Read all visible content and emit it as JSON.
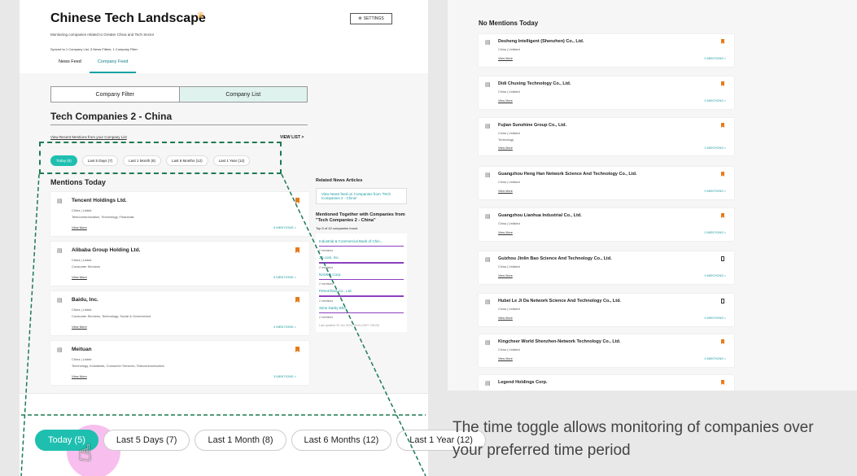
{
  "app": {
    "title": "Chinese Tech Landscape",
    "subtitle": "Monitoring companies related to Greater China and Tech Sector",
    "synced": "Synced to 1 Company List, 3 News Filters, 1 Company Filter",
    "settings_label": "SETTINGS",
    "tabs": [
      "News Feed",
      "Company Feed"
    ]
  },
  "segment": {
    "left": "Company Filter",
    "right": "Company List"
  },
  "section": {
    "title": "Tech Companies 2 - China",
    "recent_link": "View Recent Mentions from your Company List",
    "view_list": "VIEW LIST >"
  },
  "time_pills": [
    "Today (5)",
    "Last 5 Days (7)",
    "Last 1 Month (8)",
    "Last 6 Months (12)",
    "Last 1 Year (12)"
  ],
  "mentions_title": "Mentions Today",
  "mention_cards": [
    {
      "name": "Tencent Holdings Ltd.",
      "status": "China | Listed",
      "tags": "Telecommunication, Technology, Financials",
      "view": "View More",
      "mentions": "9 MENTIONS >"
    },
    {
      "name": "Alibaba Group Holding Ltd.",
      "status": "China | Listed",
      "tags": "Consumer Services",
      "view": "View More",
      "mentions": "5 MENTIONS >"
    },
    {
      "name": "Baidu, Inc.",
      "status": "China | Listed",
      "tags": "Consumer Services, Technology, Social & Government",
      "view": "View More",
      "mentions": "4 MENTIONS >"
    },
    {
      "name": "Meituan",
      "status": "China | Listed",
      "tags": "Technology, Industrials, Consumer Services, Telecommunication",
      "view": "View More",
      "mentions": "3 MENTIONS >"
    }
  ],
  "side": {
    "related_title": "Related News Articles",
    "related_link": "View News feed on Companies from \"Tech Companies 2 - China\"",
    "together_title": "Mentioned Together with Companies from \"Tech Companies 2 - China\"",
    "found": "Top 5 of 42 companies found",
    "companies": [
      {
        "name": "Industrial & Commercial Bank of Chin...",
        "mentions": "2 mentions"
      },
      {
        "name": "JD.com, Inc.",
        "mentions": "2 mentions"
      },
      {
        "name": "NAVER Corp.",
        "mentions": "2 mentions"
      },
      {
        "name": "PetroChina Co., Ltd.",
        "mentions": "2 mentions"
      },
      {
        "name": "Sime Darby Bhd.",
        "mentions": "2 mentions"
      }
    ],
    "updated": "Last updated 03 Jun 2022, 16:09 (GMT +08:00)"
  },
  "no_mentions_title": "No Mentions Today",
  "no_mention_cards": [
    {
      "name": "Desheng Intelligent (Shenzhen) Co., Ltd.",
      "status": "China | Unlisted",
      "tags": "",
      "view": "View More",
      "mentions": "0 MENTIONS >",
      "bookmarked": true
    },
    {
      "name": "Didi Chuxing Technology Co., Ltd.",
      "status": "China | Unlisted",
      "tags": "",
      "view": "View More",
      "mentions": "0 MENTIONS >",
      "bookmarked": true
    },
    {
      "name": "Fujian Sunshine Group Co., Ltd.",
      "status": "China | Unlisted",
      "tags": "Technology",
      "view": "View More",
      "mentions": "0 MENTIONS >",
      "bookmarked": true
    },
    {
      "name": "Guangzhou Heng Han Network Science And Technology Co., Ltd.",
      "status": "China | Unlisted",
      "tags": "",
      "view": "View More",
      "mentions": "0 MENTIONS >",
      "bookmarked": true
    },
    {
      "name": "Guangzhou Lianhua Industrial Co., Ltd.",
      "status": "China | Unlisted",
      "tags": "",
      "view": "View More",
      "mentions": "0 MENTIONS >",
      "bookmarked": true
    },
    {
      "name": "Guizhou Jinlin Bao Science And Technology Co., Ltd.",
      "status": "China | Unlisted",
      "tags": "",
      "view": "View More",
      "mentions": "0 MENTIONS >",
      "bookmarked": false
    },
    {
      "name": "Hubei Le Ji Da Network Science And Technology Co., Ltd.",
      "status": "China | Unlisted",
      "tags": "",
      "view": "View More",
      "mentions": "0 MENTIONS >",
      "bookmarked": false
    },
    {
      "name": "Kingcheer World Shenzhen-Network Technology Co., Ltd.",
      "status": "China | Unlisted",
      "tags": "",
      "view": "View More",
      "mentions": "0 MENTIONS >",
      "bookmarked": true
    },
    {
      "name": "Legend Holdings Corp.",
      "status": "",
      "tags": "",
      "view": "",
      "mentions": "",
      "bookmarked": true
    }
  ],
  "caption": "The time toggle allows monitoring of companies over your preferred time period",
  "colors": {
    "accent": "#1fbfb0",
    "bookmark": "#e57b1c",
    "link": "#1a9aa0",
    "dash": "#1d7a52",
    "highlight": "#f7b8ec"
  },
  "icons": {
    "crown": "crown-icon",
    "settings": "gear-icon",
    "company": "building-icon",
    "bookmark": "bookmark-icon",
    "pointer": "hand-pointer-icon"
  }
}
